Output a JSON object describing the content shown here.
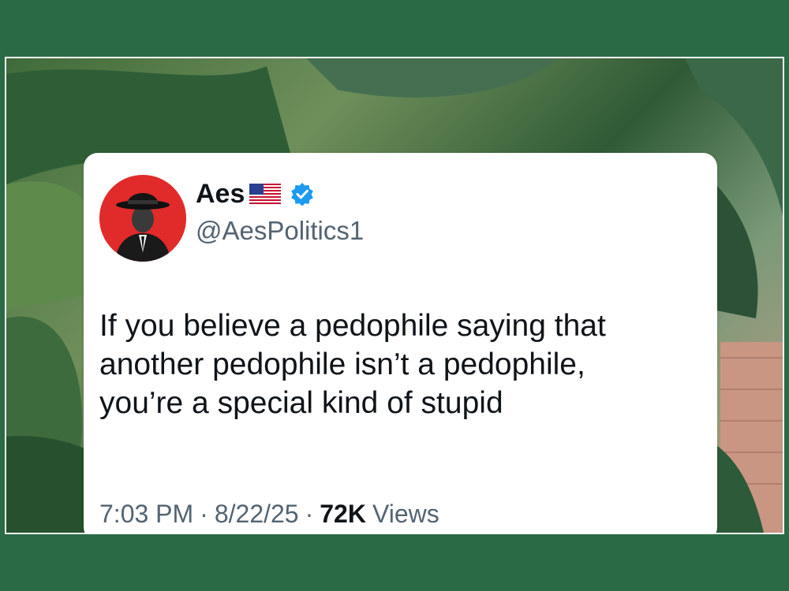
{
  "tweet": {
    "display_name": "Aes",
    "handle": "@AesPolitics1",
    "text_lines": [
      "If you believe a pedophile saying that",
      "another pedophile isn’t a pedophile,",
      "you’re a special kind of stupid"
    ],
    "time": "7:03 PM",
    "separator": "·",
    "date": "8/22/25",
    "views_count": "72K",
    "views_label": "Views"
  },
  "icons": {
    "avatar": "man-in-fedora-avatar",
    "flag": "us-flag-icon",
    "verified": "verified-badge-icon"
  },
  "colors": {
    "frame": "#2a6a44",
    "avatar_bg": "#e12a2a",
    "verified_blue": "#1d9bf0",
    "text_primary": "#0f1419",
    "text_secondary": "#536471"
  }
}
